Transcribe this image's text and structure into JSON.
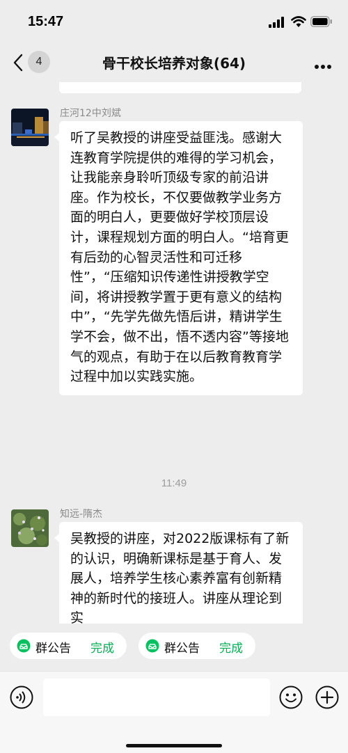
{
  "status_bar": {
    "time": "15:47"
  },
  "nav": {
    "back_badge": "4",
    "title": "骨干校长培养对象(64)"
  },
  "messages": [
    {
      "sender": "庄河12中刘斌",
      "text": "听了吴教授的讲座受益匪浅。感谢大连教育学院提供的难得的学习机会，让我能亲身聆听顶级专家的前沿讲座。作为校长，不仅要做教学业务方面的明白人，更要做好学校顶层设计，课程规划方面的明白人。“培育更有后劲的心智灵活性和可迁移性”，“压缩知识传递性讲授教学空间，将讲授教学置于更有意义的结构中”，“先学先做先悟后讲，精讲学生学不会，做不出，悟不透内容”等接地气的观点，有助于在以后教育教育学过程中加以实践实施。"
    },
    {
      "sender": "知远-隋杰",
      "text": "吴教授的讲座，对2022版课标有了新的认识，明确新课标是基于育人、发展人，培养学生核心素养富有创新精神的新时代的接班人。讲座从理论到实"
    }
  ],
  "time_divider": "11:49",
  "notices": [
    {
      "label": "群公告",
      "status": "完成"
    },
    {
      "label": "群公告",
      "status": "完成"
    }
  ],
  "input": {
    "placeholder": ""
  },
  "colors": {
    "background": "#ededed",
    "bubble": "#ffffff",
    "accent_green": "#06ae56"
  }
}
